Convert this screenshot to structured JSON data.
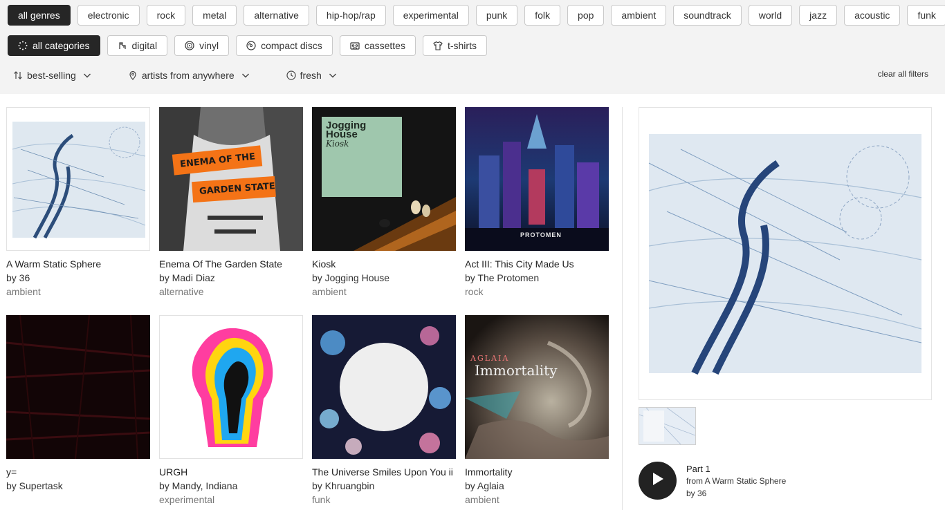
{
  "genres": [
    "all genres",
    "electronic",
    "rock",
    "metal",
    "alternative",
    "hip-hop/rap",
    "experimental",
    "punk",
    "folk",
    "pop",
    "ambient",
    "soundtrack",
    "world",
    "jazz",
    "acoustic",
    "funk"
  ],
  "categories": [
    {
      "label": "all categories",
      "icon": "sparkle-icon"
    },
    {
      "label": "digital",
      "icon": "digital-icon"
    },
    {
      "label": "vinyl",
      "icon": "vinyl-icon"
    },
    {
      "label": "compact discs",
      "icon": "cd-icon"
    },
    {
      "label": "cassettes",
      "icon": "cassette-icon"
    },
    {
      "label": "t-shirts",
      "icon": "tshirt-icon"
    }
  ],
  "sort": {
    "label": "best-selling",
    "icon": "sort-arrows-icon"
  },
  "location": {
    "label": "artists from anywhere",
    "icon": "location-pin-icon"
  },
  "format": {
    "label": "fresh",
    "icon": "clock-icon"
  },
  "clear_filters": "clear all filters",
  "albums": [
    {
      "title": "A Warm Static Sphere",
      "artist": "by 36",
      "genre": "ambient",
      "cover_text": ""
    },
    {
      "title": "Enema Of The Garden State",
      "artist": "by Madi Diaz",
      "genre": "alternative",
      "cover_text": "ENEMA OF THE",
      "cover_text_2": "GARDEN STATE"
    },
    {
      "title": "Kiosk",
      "artist": "by Jogging House",
      "genre": "ambient",
      "cover_text": "Jogging",
      "cover_text_2": "House",
      "cover_text_3": "Kiosk"
    },
    {
      "title": "Act III: This City Made Us",
      "artist": "by The Protomen",
      "genre": "rock",
      "cover_text": "PROTOMEN"
    },
    {
      "title": "y=",
      "artist": "by Supertask",
      "genre": ""
    },
    {
      "title": "URGH",
      "artist": "by Mandy, Indiana",
      "genre": "experimental"
    },
    {
      "title": "The Universe Smiles Upon You ii",
      "artist": "by Khruangbin",
      "genre": "funk"
    },
    {
      "title": "Immortality",
      "artist": "by Aglaia",
      "genre": "ambient",
      "cover_text": "AGLAIA",
      "cover_text_2": "Immortality"
    }
  ],
  "player": {
    "track": "Part 1",
    "from": "from A Warm Static Sphere",
    "by": "by 36"
  },
  "colors": {
    "accent_dark": "#262626",
    "filter_bg": "#f3f3f3",
    "orange_label": "#f47316"
  }
}
